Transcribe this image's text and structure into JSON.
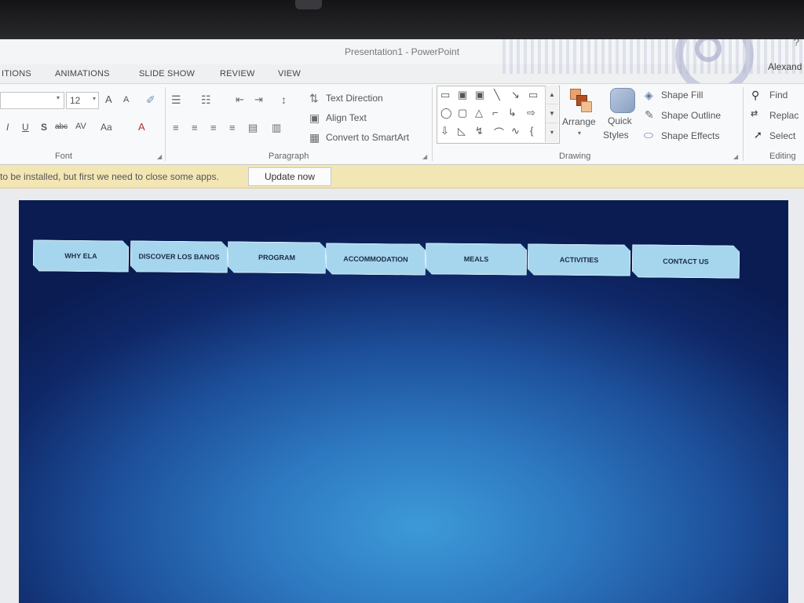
{
  "window": {
    "title": "Presentation1 - PowerPoint",
    "user": "Alexand",
    "help": "?"
  },
  "tabs": [
    "ITIONS",
    "ANIMATIONS",
    "SLIDE SHOW",
    "REVIEW",
    "VIEW"
  ],
  "font_group": {
    "size": "12",
    "grow": "A",
    "shrink": "A",
    "italic": "I",
    "underline": "U",
    "strike": "S",
    "strikethrough": "abc",
    "spacing": "AV",
    "case": "Aa",
    "color": "A",
    "label": "Font"
  },
  "paragraph_group": {
    "text_direction": "Text Direction",
    "align_text": "Align Text",
    "convert": "Convert to SmartArt",
    "label": "Paragraph"
  },
  "drawing_group": {
    "arrange": "Arrange",
    "quick": "Quick",
    "styles": "Styles",
    "shape_fill": "Shape Fill",
    "shape_outline": "Shape Outline",
    "shape_effects": "Shape Effects",
    "label": "Drawing"
  },
  "editing_group": {
    "find": "Find",
    "replace": "Replac",
    "select": "Select",
    "label": "Editing"
  },
  "message_bar": {
    "text": "to be installed, but first we need to close some apps.",
    "button": "Update now"
  },
  "slide": {
    "nav": [
      "WHY ELA",
      "DISCOVER LOS BANOS",
      "PROGRAM",
      "ACCOMMODATION",
      "MEALS",
      "ACTIVITIES",
      "CONTACT US"
    ]
  },
  "colors": {
    "nav_button": "#a6d6ee",
    "slide_dark": "#0a1c52",
    "slide_light": "#3d9ad8",
    "message_bar": "#f3e6b5"
  }
}
